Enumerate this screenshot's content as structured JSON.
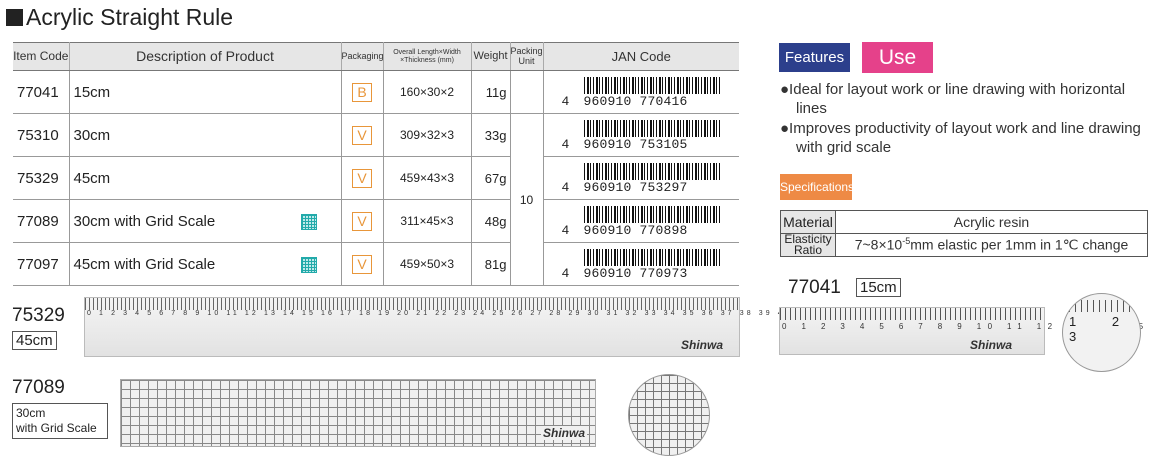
{
  "page": {
    "title": "Acrylic Straight Rule"
  },
  "table": {
    "headers": {
      "item_code": "Item Code",
      "description": "Description of Product",
      "packaging": "Packaging",
      "dims": "Overall Length×Width ×Thickness (mm)",
      "weight": "Weight",
      "packing_unit": "Packing Unit",
      "jan": "JAN Code"
    },
    "packing_unit_value": "10",
    "rows": [
      {
        "code": "77041",
        "description": "15cm",
        "packaging": "B",
        "dims": "160×30×2",
        "weight": "11g",
        "jan_prefix": "4",
        "jan": "960910 770416",
        "grid": false
      },
      {
        "code": "75310",
        "description": "30cm",
        "packaging": "V",
        "dims": "309×32×3",
        "weight": "33g",
        "jan_prefix": "4",
        "jan": "960910 753105",
        "grid": false
      },
      {
        "code": "75329",
        "description": "45cm",
        "packaging": "V",
        "dims": "459×43×3",
        "weight": "67g",
        "jan_prefix": "4",
        "jan": "960910 753297",
        "grid": false
      },
      {
        "code": "77089",
        "description": "30cm with Grid Scale",
        "packaging": "V",
        "dims": "311×45×3",
        "weight": "48g",
        "jan_prefix": "4",
        "jan": "960910 770898",
        "grid": true
      },
      {
        "code": "77097",
        "description": "45cm with Grid Scale",
        "packaging": "V",
        "dims": "459×50×3",
        "weight": "81g",
        "jan_prefix": "4",
        "jan": "960910 770973",
        "grid": true
      }
    ]
  },
  "features": {
    "tag_features": "Features",
    "tag_use": "Use",
    "bullets": [
      "●Ideal for layout work or line drawing with horizontal lines",
      "●Improves productivity of layout work and line drawing with grid scale"
    ]
  },
  "specifications": {
    "tag": "Specifications",
    "rows": [
      {
        "key": "Material",
        "value": "Acrylic resin"
      },
      {
        "key": "Elasticity Ratio",
        "value": "7~8×10-5mm elastic per 1mm in 1℃ change"
      }
    ]
  },
  "images": {
    "rule45": {
      "code": "75329",
      "label": "45cm",
      "scale_numbers": "0 1 2 3 4 5 6 7 8 9 10 11 12 13 14 15 16 17 18 19 20 21 22 23 24 25 26 27 28 29 30 31 32 33 34 35 36 37 38 39 40 41 42 43 44 45"
    },
    "rule15": {
      "code": "77041",
      "label": "15cm",
      "scale_numbers": "0 1 2 3 4 5 6 7 8 9 10 11 12 13 14 15",
      "zoom_numbers": "1 2 3"
    },
    "grid30": {
      "code": "77089",
      "label_line1": "30cm",
      "label_line2": "with Grid Scale"
    }
  }
}
